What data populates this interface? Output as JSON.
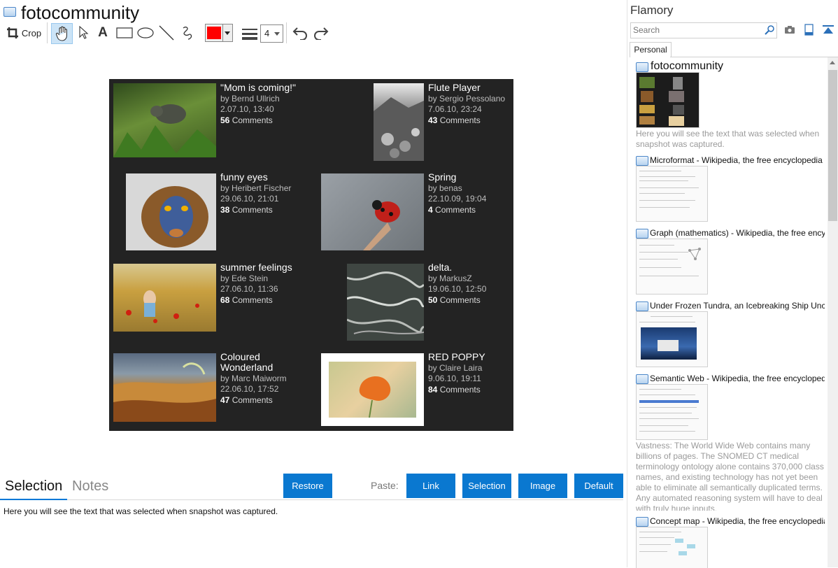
{
  "window": {
    "title": "fotocommunity"
  },
  "toolbar": {
    "crop_label": "Crop",
    "line_width": "4"
  },
  "gallery": {
    "items": [
      {
        "title": "\"Mom is coming!\"",
        "author": "by Bernd Ullrich",
        "date": "2.07.10, 13:40",
        "count": "56",
        "comments": "Comments"
      },
      {
        "title": "Flute Player",
        "author": "by Sergio Pessolano",
        "date": "7.06.10, 23:24",
        "count": "43",
        "comments": "Comments"
      },
      {
        "title": "funny eyes",
        "author": "by Heribert Fischer",
        "date": "29.06.10, 21:01",
        "count": "38",
        "comments": "Comments"
      },
      {
        "title": "Spring",
        "author": "by benas",
        "date": "22.10.09, 19:04",
        "count": "4",
        "comments": "Comments"
      },
      {
        "title": "summer feelings",
        "author": "by Ede Stein",
        "date": "27.06.10, 11:36",
        "count": "68",
        "comments": "Comments"
      },
      {
        "title": "delta.",
        "author": "by MarkusZ",
        "date": "19.06.10, 12:50",
        "count": "50",
        "comments": "Comments"
      },
      {
        "title": "Coloured Wonderland",
        "author": "by Marc Maiworm",
        "date": "22.06.10, 17:52",
        "count": "47",
        "comments": "Comments"
      },
      {
        "title": "RED POPPY",
        "author": "by Claire Laira",
        "date": "9.06.10, 19:11",
        "count": "84",
        "comments": "Comments"
      }
    ]
  },
  "bottom": {
    "tab_selection": "Selection",
    "tab_notes": "Notes",
    "restore": "Restore",
    "paste_label": "Paste:",
    "paste_link": "Link",
    "paste_selection": "Selection",
    "paste_image": "Image",
    "paste_default": "Default",
    "selection_text": "Here you will see the text that was selected when snapshot was captured."
  },
  "sidebar": {
    "title": "Flamory",
    "search_placeholder": "Search",
    "tab_personal": "Personal",
    "items": [
      {
        "title": "fotocommunity",
        "text": "Here you will see the text that was selected when snapshot was captured."
      },
      {
        "title": "Microformat - Wikipedia, the free encyclopedia"
      },
      {
        "title": "Graph (mathematics) - Wikipedia, the free ency"
      },
      {
        "title": "Under Frozen Tundra, an Icebreaking Ship Unco"
      },
      {
        "title": "Semantic Web - Wikipedia, the free encycloped",
        "text": "Vastness: The World Wide Web contains many billions of pages. The SNOMED CT medical terminology ontology alone contains 370,000 class names, and existing technology has not yet been able to eliminate all semantically duplicated terms. Any automated reasoning system will have to deal with truly huge inputs."
      },
      {
        "title": "Concept map - Wikipedia, the free encyclopedia"
      }
    ]
  },
  "colors": {
    "accent": "#0a78d0",
    "pen": "#ff0000",
    "gallery_bg": "#232323"
  },
  "icons": [
    "app-icon",
    "crop-icon",
    "hand-icon",
    "pointer-icon",
    "text-icon",
    "rectangle-icon",
    "ellipse-icon",
    "line-icon",
    "freehand-icon",
    "color-picker",
    "line-width-icon",
    "undo-icon",
    "redo-icon",
    "search-icon",
    "camera-icon",
    "page-icon",
    "collapse-icon"
  ]
}
